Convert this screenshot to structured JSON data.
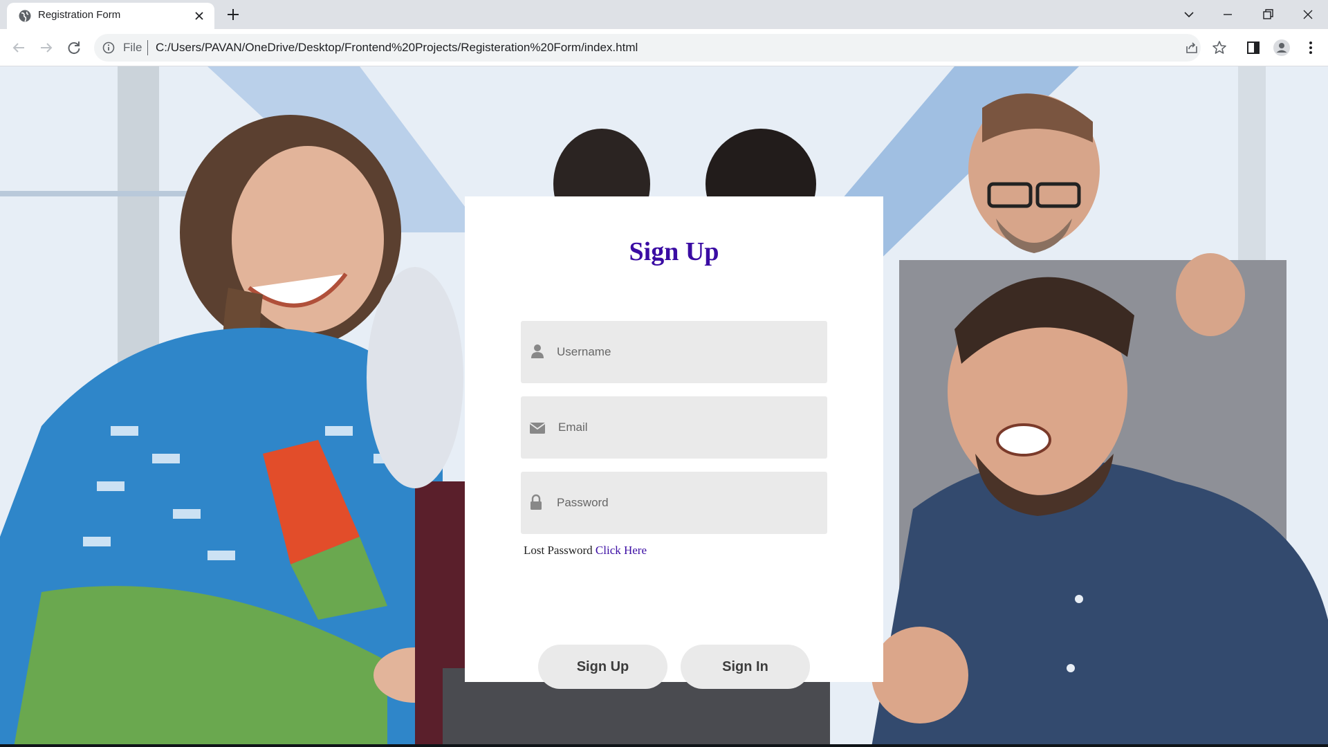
{
  "browser": {
    "tab_title": "Registration Form",
    "url_scheme": "File",
    "url": "C:/Users/PAVAN/OneDrive/Desktop/Frontend%20Projects/Registeration%20Form/index.html",
    "icons": [
      "globe-icon",
      "close-icon",
      "plus-icon",
      "chevron-down-icon",
      "minimize-icon",
      "restore-icon",
      "window-close-icon",
      "back-arrow-icon",
      "forward-arrow-icon",
      "reload-icon",
      "info-icon",
      "share-icon",
      "star-icon",
      "side-panel-icon",
      "profile-icon",
      "more-vert-icon"
    ]
  },
  "form": {
    "title": "Sign Up",
    "username_placeholder": "Username",
    "email_placeholder": "Email",
    "password_placeholder": "Password",
    "lost_password_text": "Lost Password",
    "lost_password_link": "Click Here",
    "signup_button": "Sign Up",
    "signin_button": "Sign In",
    "icons": [
      "user-icon",
      "envelope-icon",
      "lock-icon"
    ]
  },
  "colors": {
    "title": "#3a0ca3",
    "link": "#3a0ca3",
    "field_bg": "#eaeaea",
    "card_bg": "#ffffff"
  },
  "background": {
    "description_icon": "office-photo-background"
  }
}
